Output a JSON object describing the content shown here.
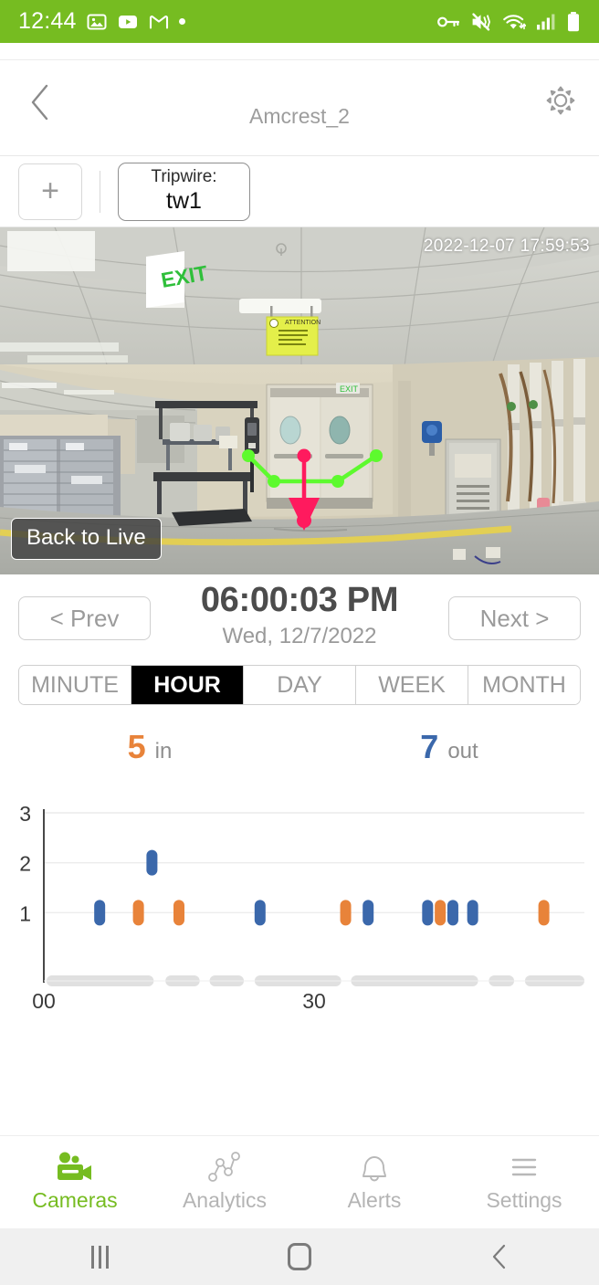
{
  "status_bar": {
    "time": "12:44",
    "left_icons": [
      "photos-icon",
      "youtube-icon",
      "gmail-icon",
      "dot-icon"
    ],
    "right_icons": [
      "vpn-key-icon",
      "mute-vibrate-icon",
      "wifi-icon",
      "cellular-signal-icon",
      "battery-icon"
    ],
    "background_color": "#76bc21",
    "foreground_color": "#ffffff"
  },
  "header": {
    "back_label": "back",
    "title": "Amcrest_2",
    "settings_label": "settings"
  },
  "tripwire_bar": {
    "add_label": "+",
    "tripwire_caption": "Tripwire:",
    "tripwire_value": "tw1"
  },
  "camera": {
    "timestamp": "2022-12-07 17:59:53",
    "back_to_live_label": "Back to Live",
    "tripwire_line_color": "#5dfa2e",
    "direction_arrow_color": "#ff1a5e"
  },
  "playback": {
    "prev_label": "< Prev",
    "next_label": "Next >",
    "time": "06:00:03 PM",
    "date": "Wed, 12/7/2022"
  },
  "range_tabs": {
    "items": [
      "MINUTE",
      "HOUR",
      "DAY",
      "WEEK",
      "MONTH"
    ],
    "active": "HOUR"
  },
  "counters": {
    "in_value": "5",
    "in_label": "in",
    "in_color": "#e8833a",
    "out_value": "7",
    "out_label": "out",
    "out_color": "#3b68ab"
  },
  "chart_data": {
    "type": "scatter",
    "title": "",
    "xlabel": "",
    "ylabel": "",
    "xlim": [
      0,
      60
    ],
    "ylim": [
      0,
      3
    ],
    "yticks": [
      1,
      2,
      3
    ],
    "xticks": [
      0,
      30
    ],
    "xtick_labels": [
      "00",
      "30"
    ],
    "grid": true,
    "legend_position": "none",
    "series": [
      {
        "name": "in",
        "color": "#e8833a",
        "points": [
          {
            "x": 10.5,
            "y": 1
          },
          {
            "x": 15.0,
            "y": 1
          },
          {
            "x": 33.5,
            "y": 1
          },
          {
            "x": 44.0,
            "y": 1
          },
          {
            "x": 55.5,
            "y": 1
          }
        ]
      },
      {
        "name": "out",
        "color": "#3b68ab",
        "points": [
          {
            "x": 6.2,
            "y": 1
          },
          {
            "x": 12.0,
            "y": 2
          },
          {
            "x": 24.0,
            "y": 1
          },
          {
            "x": 36.0,
            "y": 1
          },
          {
            "x": 42.6,
            "y": 1
          },
          {
            "x": 45.4,
            "y": 1
          },
          {
            "x": 47.6,
            "y": 1
          }
        ]
      }
    ],
    "recording_track": {
      "color": "#e0e0e0",
      "segments": [
        {
          "start": 0.3,
          "end": 12.2
        },
        {
          "start": 13.5,
          "end": 17.3
        },
        {
          "start": 18.4,
          "end": 22.2
        },
        {
          "start": 23.4,
          "end": 33.0
        },
        {
          "start": 34.1,
          "end": 48.2
        },
        {
          "start": 49.4,
          "end": 52.2
        },
        {
          "start": 53.4,
          "end": 60.0
        }
      ]
    }
  },
  "tab_bar": {
    "items": [
      {
        "label": "Cameras",
        "icon": "video-camera-icon",
        "active": true
      },
      {
        "label": "Analytics",
        "icon": "analytics-graph-icon",
        "active": false
      },
      {
        "label": "Alerts",
        "icon": "bell-icon",
        "active": false
      },
      {
        "label": "Settings",
        "icon": "hamburger-menu-icon",
        "active": false
      }
    ],
    "active_color": "#76bc21",
    "inactive_color": "#b4b4b4"
  },
  "android_nav": {
    "recent_label": "recent-apps",
    "home_label": "home",
    "back_label": "back"
  }
}
